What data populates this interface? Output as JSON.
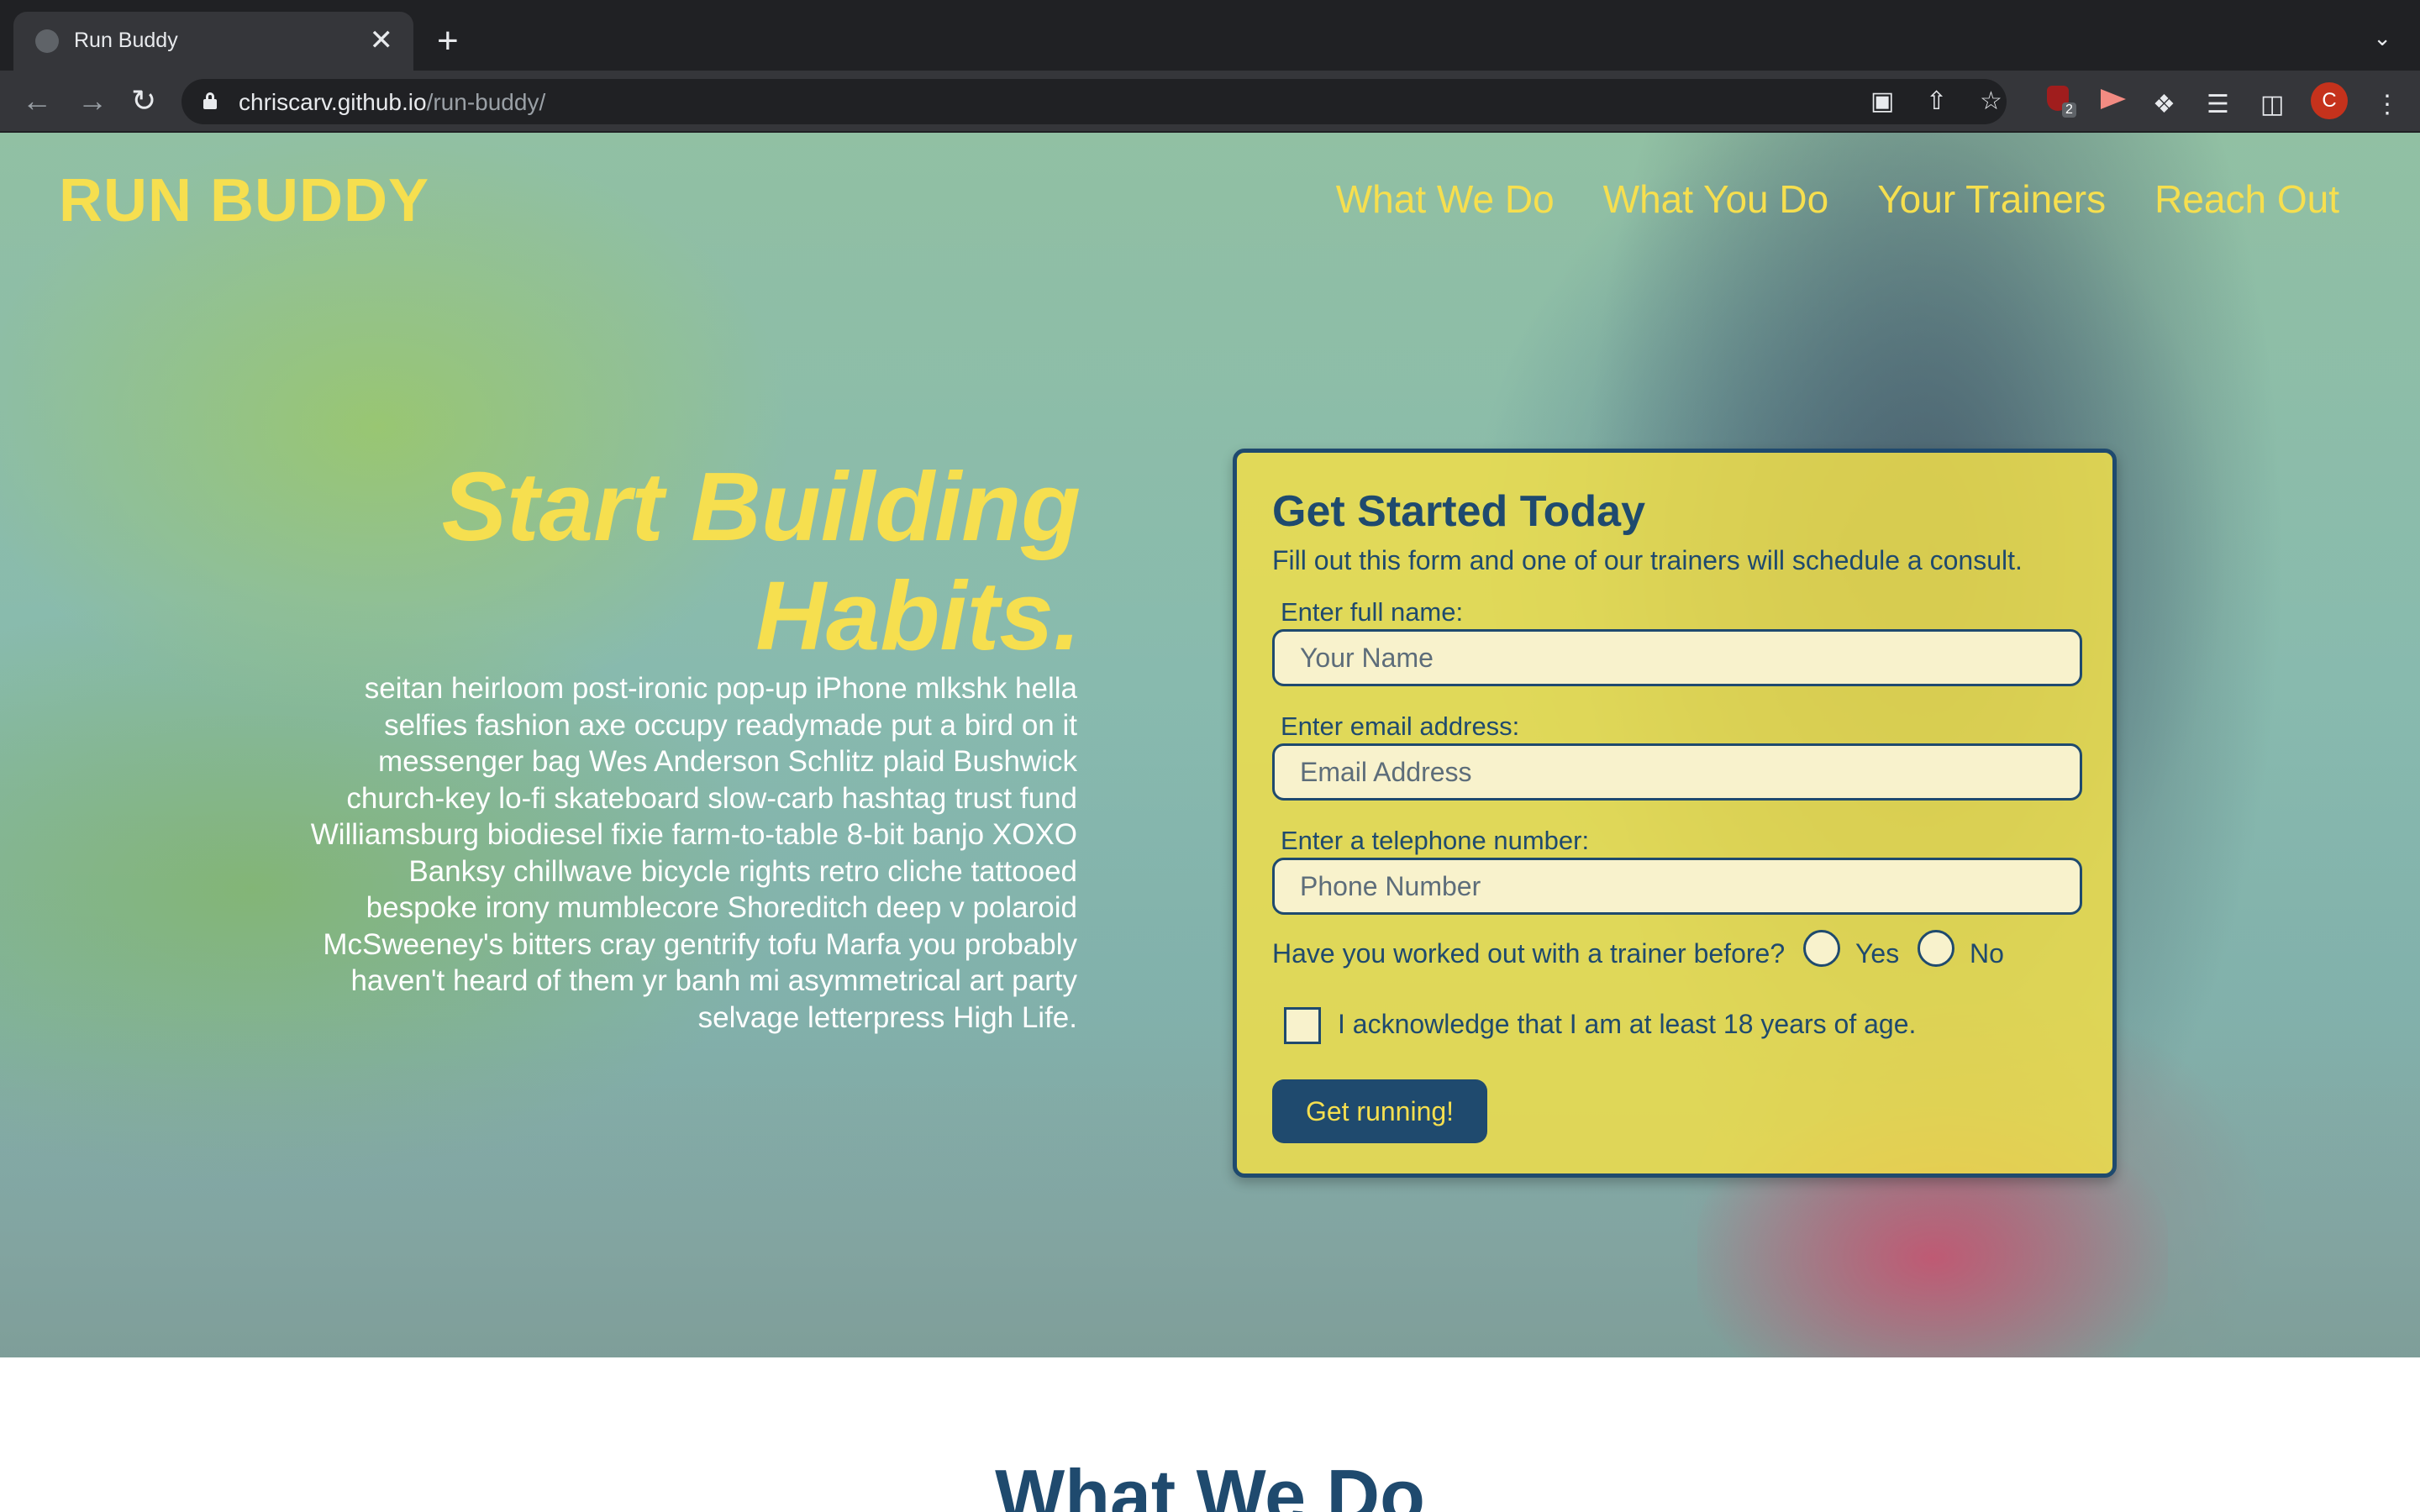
{
  "browser": {
    "tab_title": "Run Buddy",
    "tab_close": "✕",
    "new_tab": "+",
    "url_host": "chriscarv.github.io",
    "url_path": "/run-buddy/",
    "extension_badge": "2",
    "profile_initial": "C"
  },
  "header": {
    "brand": "RUN BUDDY",
    "nav": [
      "What We Do",
      "What You Do",
      "Your Trainers",
      "Reach Out"
    ]
  },
  "hero": {
    "headline": "Start Building Habits.",
    "body": "seitan heirloom post-ironic pop-up iPhone mlkshk hella selfies fashion axe occupy readymade put a bird on it messenger bag Wes Anderson Schlitz plaid Bushwick church-key lo-fi skateboard slow-carb hashtag trust fund Williamsburg biodiesel fixie farm-to-table 8-bit banjo XOXO Banksy chillwave bicycle rights retro cliche tattooed bespoke irony mumblecore Shoreditch deep v polaroid McSweeney's bitters cray gentrify tofu Marfa you probably haven't heard of them yr banh mi asymmetrical art party selvage letterpress High Life."
  },
  "form": {
    "title": "Get Started Today",
    "subtitle": "Fill out this form and one of our trainers will schedule a consult.",
    "name_label": "Enter full name:",
    "name_placeholder": "Your Name",
    "email_label": "Enter email address:",
    "email_placeholder": "Email Address",
    "phone_label": "Enter a telephone number:",
    "phone_placeholder": "Phone Number",
    "question": "Have you worked out with a trainer before?",
    "yes_label": "Yes",
    "no_label": "No",
    "acknowledge": "I acknowledge that I am at least 18 years of age.",
    "submit": "Get running!"
  },
  "next_section": {
    "title": "What We Do"
  },
  "colors": {
    "accent_yellow": "#f6df4f",
    "brand_blue": "#1f4a6e"
  }
}
